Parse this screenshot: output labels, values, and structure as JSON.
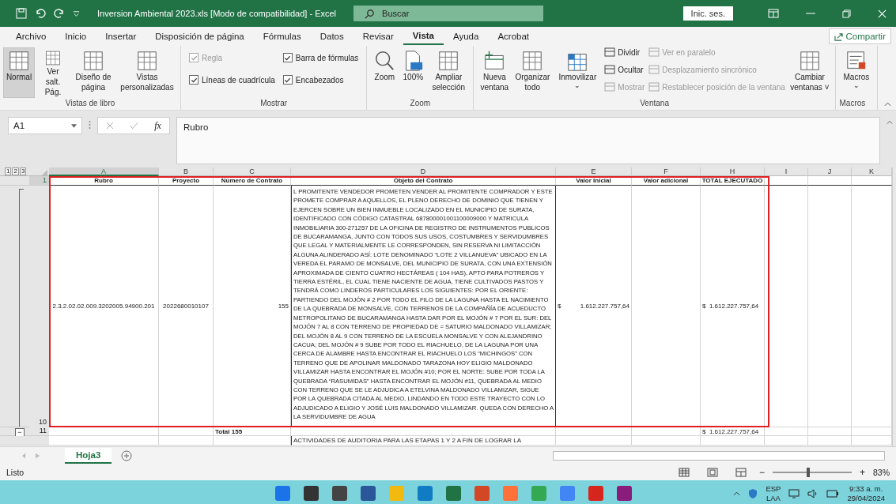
{
  "window": {
    "title": "Inversion Ambiental 2023.xls  [Modo de compatibilidad]  -  Excel",
    "search_placeholder": "Buscar",
    "sign_in": "Inic. ses."
  },
  "menu_tabs": [
    {
      "label": "Archivo",
      "selected": false
    },
    {
      "label": "Inicio",
      "selected": false
    },
    {
      "label": "Insertar",
      "selected": false
    },
    {
      "label": "Disposición de página",
      "selected": false
    },
    {
      "label": "Fórmulas",
      "selected": false
    },
    {
      "label": "Datos",
      "selected": false
    },
    {
      "label": "Revisar",
      "selected": false
    },
    {
      "label": "Vista",
      "selected": true
    },
    {
      "label": "Ayuda",
      "selected": false
    },
    {
      "label": "Acrobat",
      "selected": false
    }
  ],
  "share_button": "Compartir",
  "ribbon": {
    "groups": [
      {
        "title": "Vistas de libro",
        "items": [
          {
            "kind": "normal",
            "label": "Normal",
            "selected": true,
            "disabled": false
          },
          {
            "kind": "pagebreak",
            "label": "Ver salt. Pág.",
            "selected": false,
            "disabled": false
          },
          {
            "kind": "pagelayout",
            "label": "Diseño de página",
            "selected": false,
            "disabled": false
          },
          {
            "kind": "customviews",
            "label": "Vistas personalizadas",
            "selected": false,
            "disabled": false
          }
        ]
      },
      {
        "title": "Mostrar",
        "items": [
          {
            "kind": "check",
            "label": "Regla",
            "checked": true,
            "disabled": true
          },
          {
            "kind": "check",
            "label": "Líneas de cuadrícula",
            "checked": true,
            "disabled": false
          },
          {
            "kind": "check",
            "label": "Barra de fórmulas",
            "checked": true,
            "disabled": false
          },
          {
            "kind": "check",
            "label": "Encabezados",
            "checked": true,
            "disabled": false
          }
        ]
      },
      {
        "title": "Zoom",
        "items": [
          {
            "kind": "zoom",
            "label": "Zoom",
            "selected": false,
            "disabled": false
          },
          {
            "kind": "hundred",
            "label": "100%",
            "selected": false,
            "disabled": false
          },
          {
            "kind": "zoomselection",
            "label": "Ampliar selección",
            "selected": false,
            "disabled": false
          }
        ]
      },
      {
        "title": "Ventana",
        "items": [
          {
            "kind": "newwindow",
            "label": "Nueva ventana",
            "selected": false,
            "disabled": false
          },
          {
            "kind": "arrange",
            "label": "Organizar todo",
            "selected": false,
            "disabled": false
          },
          {
            "kind": "freeze",
            "label": "Inmovilizar",
            "selected": false,
            "disabled": false,
            "caret": "⌄"
          },
          {
            "kind": "small",
            "label": "Dividir",
            "disabled": false
          },
          {
            "kind": "small",
            "label": "Ocultar",
            "disabled": false
          },
          {
            "kind": "small",
            "label": "Mostrar",
            "disabled": true
          },
          {
            "kind": "small",
            "label": "Ver en paralelo",
            "disabled": true
          },
          {
            "kind": "small",
            "label": "Desplazamiento sincrónico",
            "disabled": true
          },
          {
            "kind": "small",
            "label": "Restablecer posición de la ventana",
            "disabled": true
          },
          {
            "kind": "switchwindows",
            "label": "Cambiar ventanas ˅",
            "selected": false,
            "disabled": false
          }
        ]
      },
      {
        "title": "Macros",
        "items": [
          {
            "kind": "macros",
            "label": "Macros",
            "selected": false,
            "disabled": false,
            "caret": "⌄"
          }
        ]
      }
    ]
  },
  "formula_bar": {
    "name_box": "A1",
    "fx": "fx",
    "value": "Rubro"
  },
  "outline_levels": [
    "1",
    "2",
    "3"
  ],
  "sheet": {
    "columns": [
      {
        "letter": "A",
        "selected": true
      },
      {
        "letter": "B",
        "selected": false
      },
      {
        "letter": "C",
        "selected": false
      },
      {
        "letter": "D",
        "selected": false
      },
      {
        "letter": "E",
        "selected": false
      },
      {
        "letter": "F",
        "selected": false
      },
      {
        "letter": "H",
        "selected": false
      },
      {
        "letter": "I",
        "selected": false
      },
      {
        "letter": "J",
        "selected": false
      },
      {
        "letter": "K",
        "selected": false
      }
    ],
    "rows": [
      {
        "number": "1",
        "selected": true,
        "kind": "header",
        "cells": [
          {
            "text": "Rubro"
          },
          {
            "text": "Proyecto"
          },
          {
            "text": "Número de Contrato"
          },
          {
            "text": "Objeto del Contrato"
          },
          {
            "text": "Valor Inicial"
          },
          {
            "text": "Valor adicional"
          },
          {
            "text": "TOTAL EJECUTADO"
          },
          {},
          {},
          {}
        ]
      },
      {
        "number": "10",
        "selected": false,
        "kind": "data",
        "cells": [
          {
            "text": "2.3.2.02.02.009.3202005.94900.201"
          },
          {
            "text": "2022680010107"
          },
          {
            "text": "155"
          },
          {
            "text": "L PROMITENTE VENDEDOR PROMETEN VENDER AL PROMITENTE COMPRADOR Y ESTE PROMETE COMPRAR A AQUELLOS, EL PLENO DERECHO DE DOMINIO QUE TIENEN Y EJERCEN SOBRE UN BIEN INMUEBLE LOCALIZADO EN EL MUNICIPIO DE SURATA, IDENTIFICADO CON CÓDIGO CATASTRAL 687800001001100009000 Y MATRICULA INMOBILIARIA 300-271257 DE LA OFICINA DE REGISTRO DE INSTRUMENTOS PUBLICOS DE BUCARAMANGA, JUNTO CON TODOS SUS USOS, COSTUMBRES Y SERVIDUMBRES QUE LEGAL Y MATERIALMENTE LE CORRESPONDEN, SIN RESERVA NI LIMITACCIÓN ALGUNA ALINDERADO ASÍ: LOTE DENOMINADO “LOTE 2 VILLANUEVA” UBICADO EN LA VEREDA EL PARAMO DE MONSALVE, DEL MUNICIPIO DE SURATA, CON UNA EXTENSIÓN APROXIMADA DE CIENTO CUATRO HECTÁREAS ( 104 HAS), APTO PARA POTREROS Y TIERRA ESTÉRIL, EL CUAL TIENE NACIENTE DE AGUA, TIENE CULTIVADOS PASTOS Y TENDRÁ COMO LINDEROS PARTICULARES LOS SIGUIENTES: POR EL ORIENTE: PARTIENDO DEL MOJÓN # 2 POR TODO EL FILO DE LA LAGUNA HASTA EL NACIMIENTO DE LA QUEBRADA DE MONSALVE, CON TERRENOS DE LA COMPAÑÍA DE ACUEDUCTO METROPOLITANO DE BUCARAMANGA HASTA DAR POR EL MOJÓN # 7 POR EL SUR: DEL MOJÓN 7 AL 8 CON TERRENO DE PROPIEDAD DE = SATURIO MALDONADO VILLAMIZAR; DEL MOJÓN 8 AL 9 CON TERRENO DE LA ESCUELA MONSALVE Y CON ALEJANDRINO CACUA; DEL MOJÓN # 9 SUBE POR TODO EL RIACHUELO, DE LA LAGUNA POR UNA CERCA DE ALAMBRE HASTA ENCONTRAR EL RIACHUELO LOS “MICHINGOS” CON TERRENO QUE DE APOLINAR MALDONADO TARAZONA HOY ELIGIO MALDONADO VILLAMIZAR HASTA ENCONTRAR EL MOJÓN #10; POR EL NORTE: SUBE POR TODA LA QUEBRADA “RASUMIDAS” HASTA ENCONTRAR EL MOJÓN #11, QUEBRADA AL MEDIO CON TERRENO QUE SE LE ADJUDICA A ETELVINA MALDONADO VILLAMIZAR, SIGUE POR LA QUEBRADA CITADA AL MEDIO, LINDANDO EN TODO ESTE TRAYECTO CON LO ADJUDICADO A ELIGIO Y JOSÉ LUIS MALDONADO VILLAMIZAR. QUEDA CON DERECHO A LA SERVIDUMBRE DE AGUA"
          },
          {
            "currency": "$",
            "text": "1.612.227.757,64"
          },
          {},
          {
            "text": "$  1.612.227.757,64"
          },
          {},
          {},
          {}
        ]
      },
      {
        "number": "11",
        "selected": false,
        "kind": "total",
        "outline_button": "−",
        "cells": [
          {},
          {},
          {
            "text": "Total 155"
          },
          {},
          {},
          {},
          {
            "text": "$  1.612.227.757,64"
          },
          {},
          {},
          {}
        ]
      },
      {
        "number": "",
        "kind": "data",
        "cells": [
          {},
          {},
          {},
          {
            "text": "ACTIVIDADES DE AUDITORIA PARA LAS ETAPAS 1 Y 2 A FIN DE LOGRAR LA"
          },
          {},
          {},
          {},
          {},
          {},
          {}
        ]
      }
    ]
  },
  "sheet_tabs": [
    {
      "label": "Hoja3",
      "selected": true
    }
  ],
  "status_bar": {
    "status": "Listo",
    "zoom_minus": "−",
    "zoom_plus": "+",
    "zoom_level": "83%",
    "zoom": {
      "level": 0.45
    }
  },
  "taskbar": {
    "language": "ESP",
    "layout": "LAA",
    "time": "9:33 a. m.",
    "date": "29/04/2024"
  }
}
